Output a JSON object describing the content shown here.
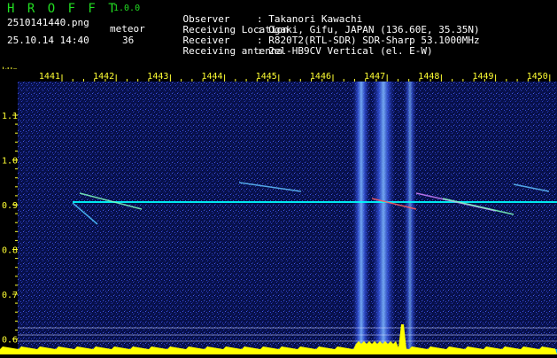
{
  "app": {
    "title": "H R O F F T",
    "version": "1.0.0"
  },
  "file": {
    "name": "2510141440.png",
    "datetime": "25.10.14 14:40"
  },
  "meteor": {
    "label": "meteor",
    "count": "36"
  },
  "info": [
    {
      "label": "Observer",
      "value": ": Takanori Kawachi"
    },
    {
      "label": "Receiving Location",
      "value": ": Ogaki, Gifu, JAPAN (136.60E, 35.35N)"
    },
    {
      "label": "Receiver",
      "value": ": R820T2(RTL-SDR) SDR-Sharp 53.1000MHz"
    },
    {
      "label": "Receiving antenna",
      "value": ": 2el-HB9CV Vertical (el. E-W)"
    }
  ],
  "axis": {
    "unit": "kHz",
    "freq_ticks": [
      "1441",
      "1442",
      "1443",
      "1444",
      "1445",
      "1446",
      "1447",
      "1448",
      "1449",
      "1450"
    ],
    "time_ticks": [
      "1.1",
      "1.0",
      "0.9",
      "0.8",
      "0.7",
      "0.6"
    ]
  },
  "colors": {
    "tick": "#ffff33",
    "header_green": "#22dd22",
    "background_noise": "#101a6e",
    "carrier": "#00ffff",
    "spectrum": "#ffff00",
    "baseline": "#00bfff"
  }
}
